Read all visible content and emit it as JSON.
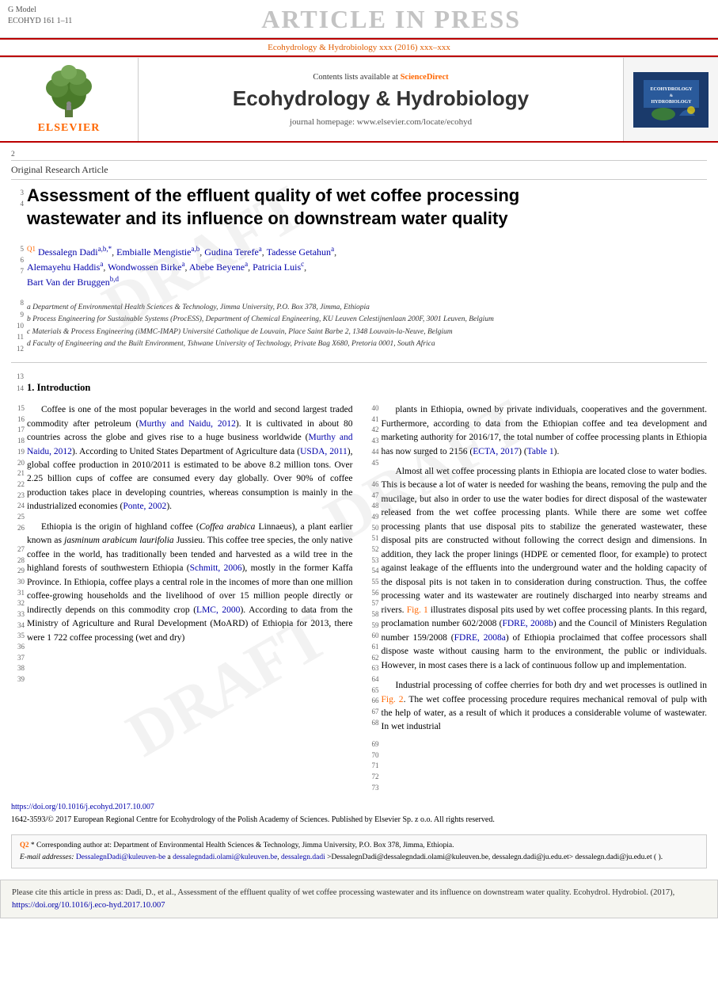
{
  "header": {
    "gmodel": "G Model",
    "ecohyd": "ECOHYD 161 1–11",
    "article_in_press": "ARTICLE IN PRESS",
    "journal_full": "Ecohydrology & Hydrobiology xxx (2016) xxx–xxx",
    "sciencedirect_text": "Contents lists available at",
    "sciencedirect_link": "ScienceDirect",
    "journal_title": "Ecohydrology & Hydrobiology",
    "homepage_text": "journal homepage: www.elsevier.com/locate/ecohyd",
    "right_logo_text": "ECOHYDROLOGY & HYDROBIOLOGY"
  },
  "article": {
    "type_label": "Original Research Article",
    "title_line1": "Assessment of the effluent quality of wet coffee processing",
    "title_line2": "wastewater and its influence on downstream water quality",
    "authors": "Dessalegn Dadi a,b,*, Embialle Mengistie a,b, Gudina Terefe a, Tadesse Getahun a, Alemayehu Haddis a, Wondwossen Birke a, Abebe Beyene a, Patricia Luis c, Bart Van der Bruggen b,d",
    "affiliations": [
      "a Department of Environmental Health Sciences & Technology, Jimma University, P.O. Box 378, Jimma, Ethiopia",
      "b Process Engineering for Sustainable Systems (ProcESS), Department of Chemical Engineering, KU Leuven Celestijnenlaan 200F, 3001 Leuven, Belgium",
      "c Materials & Process Engineering (iMMC-IMAP) Université Catholique de Louvain, Place Saint Barbe 2, 1348 Louvain-la-Neuve, Belgium",
      "d Faculty of Engineering and the Built Environment, Tshwane University of Technology, Private Bag X680, Pretoria 0001, South Africa"
    ]
  },
  "introduction": {
    "heading": "1.  Introduction",
    "col_left": {
      "para1": "Coffee is one of the most popular beverages in the world and second largest traded commodity after petroleum (Murthy and Naidu, 2012). It is cultivated in about 80 countries across the globe and gives rise to a huge business worldwide (Murthy and Naidu, 2012). According to United States Department of Agriculture data (USDA, 2011), global coffee production in 2010/2011 is estimated to be above 8.2 million tons. Over 2.25 billion cups of coffee are consumed every day globally. Over 90% of coffee production takes place in developing countries, whereas consumption is mainly in the industrialized economies (Ponte, 2002).",
      "para2": "Ethiopia is the origin of highland coffee (Coffea arabica Linnaeus), a plant earlier known as jasminum arabicum laurifolia Jussieu. This coffee tree species, the only native coffee in the world, has traditionally been tended and harvested as a wild tree in the highland forests of southwestern Ethiopia (Schmitt, 2006), mostly in the former Kaffa Province. In Ethiopia, coffee plays a central role in the incomes of more than one million coffee-growing households and the livelihood of over 15 million people directly or indirectly depends on this commodity crop (LMC, 2000). According to data from the Ministry of Agriculture and Rural Development (MoARD) of Ethiopia for 2013, there were 1 722 coffee processing (wet and dry)"
    },
    "col_right": {
      "para1": "plants in Ethiopia, owned by private individuals, cooperatives and the government. Furthermore, according to data from the Ethiopian coffee and tea development and marketing authority for 2016/17, the total number of coffee processing plants in Ethiopia has now surged to 2156 (ECTA, 2017) (Table 1).",
      "para2": "Almost all wet coffee processing plants in Ethiopia are located close to water bodies. This is because a lot of water is needed for washing the beans, removing the pulp and the mucilage, but also in order to use the water bodies for direct disposal of the wastewater released from the wet coffee processing plants. While there are some wet coffee processing plants that use disposal pits to stabilize the generated wastewater, these disposal pits are constructed without following the correct design and dimensions. In addition, they lack the proper linings (HDPE or cemented floor, for example) to protect against leakage of the effluents into the underground water and the holding capacity of the disposal pits is not taken in to consideration during construction. Thus, the coffee processing water and its wastewater are routinely discharged into nearby streams and rivers. Fig. 1 illustrates disposal pits used by wet coffee processing plants. In this regard, proclamation number 602/2008 (FDRE, 2008b) and the Council of Ministers Regulation number 159/2008 (FDRE, 2008a) of Ethiopia proclaimed that coffee processors shall dispose waste without causing harm to the environment, the public or individuals. However, in most cases there is a lack of continuous follow up and implementation.",
      "para3": "Industrial processing of coffee cherries for both dry and wet processes is outlined in Fig. 2. The wet coffee processing procedure requires mechanical removal of pulp with the help of water, as a result of which it produces a considerable volume of wastewater. In wet industrial"
    }
  },
  "line_numbers": {
    "left_start": 15,
    "right_start": 40
  },
  "doi": {
    "url": "https://doi.org/10.1016/j.ecohyd.2017.10.007",
    "issn": "1642-3593/© 2017 European Regional Centre for Ecohydrology of the Polish Academy of Sciences. Published by Elsevier Sp. z o.o. All rights reserved."
  },
  "footnote": {
    "q2_label": "Q2",
    "corresponding_text": "* Corresponding author at: Department of Environmental Health Sciences & Technology, Jimma University, P.O. Box 378, Jimma, Ethiopia.",
    "email_label": "E-mail addresses:",
    "email1": "DessalegnDadi@kuleuven-be",
    "email2": "dessalegndadi.olami@kuleuven.be",
    "email3": "dessalegn.dadi@ju.edu.et",
    "email_suffix": ">DessalegnDadi@dessalegndadi.olami@kuleuven.be, dessalegn.dadi@ju.edu.et> dessalegn.dadi@ju.edu.et ( )."
  },
  "citation": {
    "text": "Please cite this article in press as: Dadi, D., et al., Assessment of the effluent quality of wet coffee processing wastewater and its influence on downstream water quality. Ecohydrol. Hydrobiol. (2017),",
    "doi_link": "https://doi.org/10.1016/j.eco-hyd.2017.10.007"
  },
  "line_nums_left": [
    "15",
    "16",
    "17",
    "18",
    "19",
    "20",
    "21",
    "22",
    "23",
    "24",
    "25",
    "26",
    "27",
    "28",
    "29",
    "30",
    "31",
    "32",
    "33",
    "34",
    "35",
    "36",
    "37",
    "38",
    "39"
  ],
  "line_nums_right": [
    "40",
    "41",
    "42",
    "43",
    "44",
    "45",
    "46",
    "47",
    "48",
    "49",
    "50",
    "51",
    "52",
    "53",
    "54",
    "55",
    "56",
    "57",
    "58",
    "59",
    "60",
    "61",
    "62",
    "63",
    "64",
    "65",
    "66",
    "67",
    "68",
    "69",
    "70",
    "71",
    "72",
    "73"
  ]
}
